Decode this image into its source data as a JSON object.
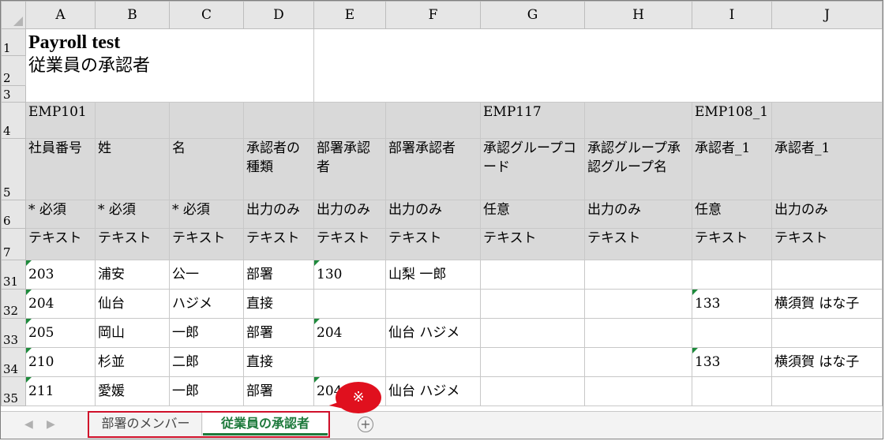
{
  "columns": [
    "A",
    "B",
    "C",
    "D",
    "E",
    "F",
    "G",
    "H",
    "I",
    "J"
  ],
  "title": {
    "line1": "Payroll test",
    "line2": "従業員の承認者"
  },
  "header_rows": [
    {
      "row": "4",
      "cells": [
        "EMP101",
        "",
        "",
        "",
        "",
        "",
        "EMP117",
        "",
        "EMP108_1",
        ""
      ]
    },
    {
      "row": "5",
      "cells": [
        "社員番号",
        "姓",
        "名",
        "承認者の種類",
        "部署承認者",
        "部署承認者",
        "承認グループコード",
        "承認グループ承認グループ名",
        "承認者_1",
        "承認者_1"
      ]
    },
    {
      "row": "6",
      "cells": [
        "* 必須",
        "* 必須",
        "* 必須",
        "出力のみ",
        "出力のみ",
        "出力のみ",
        "任意",
        "出力のみ",
        "任意",
        "出力のみ"
      ]
    },
    {
      "row": "7",
      "cells": [
        "テキスト",
        "テキスト",
        "テキスト",
        "テキスト",
        "テキスト",
        "テキスト",
        "テキスト",
        "テキスト",
        "テキスト",
        "テキスト"
      ]
    }
  ],
  "data_rows": [
    {
      "row": "31",
      "cells": [
        "203",
        "浦安",
        "公一",
        "部署",
        "130",
        "山梨 一郎",
        "",
        "",
        "",
        ""
      ]
    },
    {
      "row": "32",
      "cells": [
        "204",
        "仙台",
        "ハジメ",
        "直接",
        "",
        "",
        "",
        "",
        "133",
        "横須賀 はな子"
      ]
    },
    {
      "row": "33",
      "cells": [
        "205",
        "岡山",
        "一郎",
        "部署",
        "204",
        "仙台 ハジメ",
        "",
        "",
        "",
        ""
      ]
    },
    {
      "row": "34",
      "cells": [
        "210",
        "杉並",
        "二郎",
        "直接",
        "",
        "",
        "",
        "",
        "133",
        "横須賀 はな子"
      ]
    },
    {
      "row": "35",
      "cells": [
        "211",
        "愛媛",
        "一郎",
        "部署",
        "204",
        "仙台 ハジメ",
        "",
        "",
        "",
        ""
      ]
    }
  ],
  "row_numbers": {
    "r1": "1",
    "r2": "2",
    "r3": "3"
  },
  "tabs": [
    {
      "label": "部署のメンバー",
      "active": false
    },
    {
      "label": "従業員の承認者",
      "active": true
    }
  ],
  "nav": {
    "prev": "◀",
    "next": "▶"
  },
  "add_sheet_label": "+",
  "callout_mark": "※",
  "colors": {
    "active_tab": "#1e7a3c",
    "highlight": "#e0101e",
    "header_fill": "#d9d9d9"
  }
}
